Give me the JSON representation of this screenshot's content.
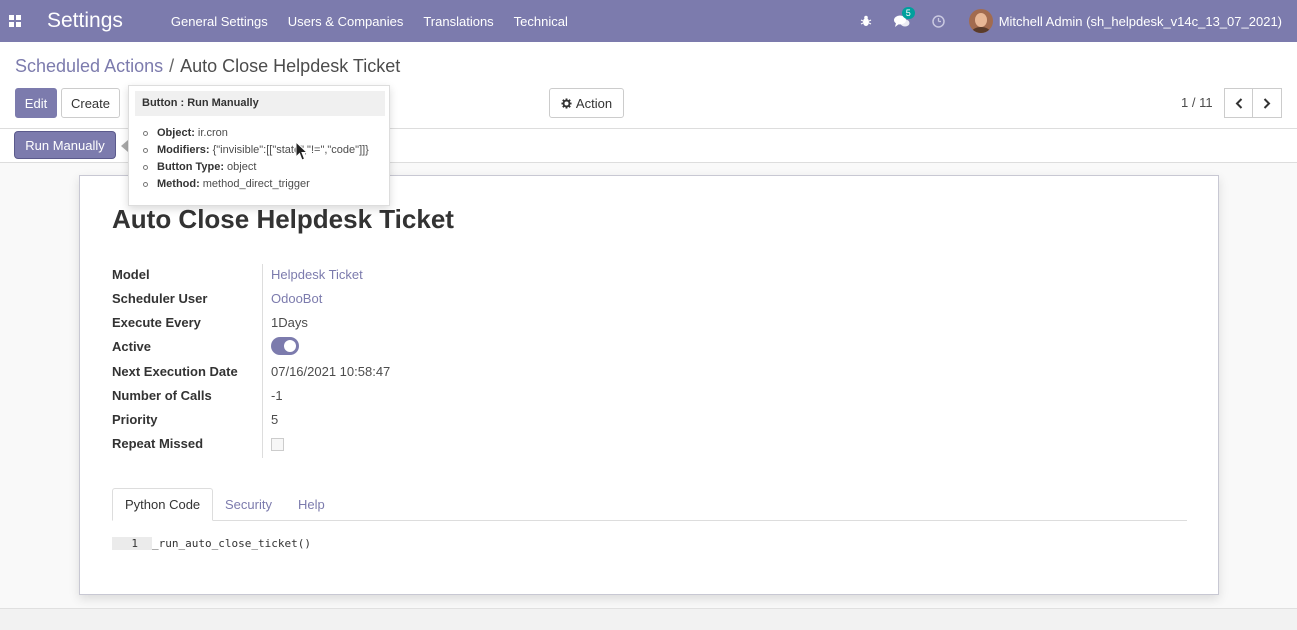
{
  "navbar": {
    "brand": "Settings",
    "menu": [
      "General Settings",
      "Users & Companies",
      "Translations",
      "Technical"
    ],
    "messages_count": "5",
    "user_name": "Mitchell Admin (sh_helpdesk_v14c_13_07_2021)"
  },
  "breadcrumb": {
    "parent": "Scheduled Actions",
    "separator": "/",
    "current": "Auto Close Helpdesk Ticket"
  },
  "buttons": {
    "edit": "Edit",
    "create": "Create",
    "action": "Action",
    "run_manually": "Run Manually"
  },
  "pager": {
    "value": "1 / 11"
  },
  "tooltip": {
    "title": "Button : Run Manually",
    "items": [
      {
        "label": "Object:",
        "value": "ir.cron"
      },
      {
        "label": "Modifiers:",
        "value": "{\"invisible\":[[\"state\",\"!=\",\"code\"]]}"
      },
      {
        "label": "Button Type:",
        "value": "object"
      },
      {
        "label": "Method:",
        "value": "method_direct_trigger"
      }
    ]
  },
  "record": {
    "title": "Auto Close Helpdesk Ticket",
    "fields": [
      {
        "label": "Model",
        "value": "Helpdesk Ticket"
      },
      {
        "label": "Scheduler User",
        "value": "OdooBot"
      },
      {
        "label": "Execute Every",
        "value": "1Days"
      },
      {
        "label": "Active",
        "value": ""
      },
      {
        "label": "Next Execution Date",
        "value": "07/16/2021 10:58:47"
      },
      {
        "label": "Number of Calls",
        "value": "-1"
      },
      {
        "label": "Priority",
        "value": "5"
      },
      {
        "label": "Repeat Missed",
        "value": ""
      }
    ],
    "active": true,
    "repeat_missed": false
  },
  "tabs": [
    "Python Code",
    "Security",
    "Help"
  ],
  "code": {
    "line_number": "1",
    "text": "_run_auto_close_ticket()"
  },
  "colors": {
    "brand": "#7c7bad",
    "badge": "#00a09d"
  },
  "icons": [
    "apps-icon",
    "bug-icon",
    "chat-icon",
    "clock-icon",
    "gear-icon",
    "chevron-left-icon",
    "chevron-right-icon"
  ]
}
